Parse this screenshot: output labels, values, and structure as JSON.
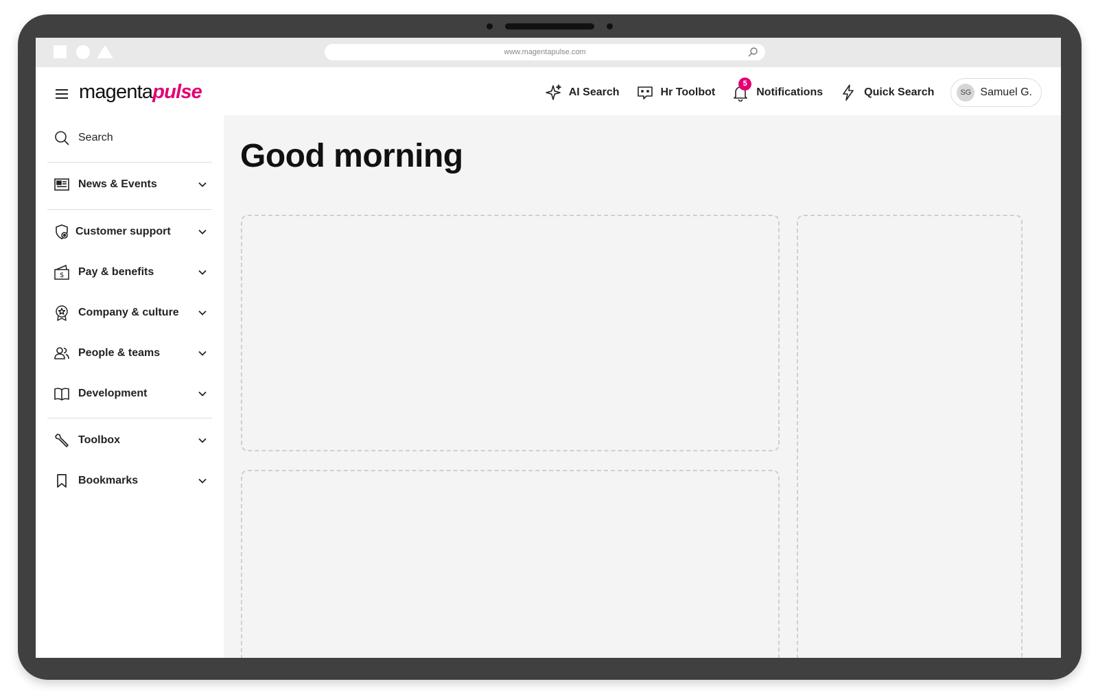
{
  "browser": {
    "url": "www.magentapulse.com"
  },
  "brand": {
    "logo_part_1": "magenta",
    "logo_part_2": "pulse",
    "accent_color": "#e20074"
  },
  "header": {
    "actions": [
      {
        "label": "AI Search",
        "icon": "sparkle-icon"
      },
      {
        "label": "Hr Toolbot",
        "icon": "chat-bot-icon"
      },
      {
        "label": "Notifications",
        "icon": "bell-icon",
        "badge": "5"
      },
      {
        "label": "Quick Search",
        "icon": "lightning-icon"
      }
    ],
    "user": {
      "initials": "SG",
      "name": "Samuel G."
    }
  },
  "sidebar": {
    "search_label": "Search",
    "items": [
      {
        "label": "News & Events",
        "icon": "newspaper-icon"
      },
      {
        "label": "Customer support",
        "icon": "shield-support-icon"
      },
      {
        "label": "Pay & benefits",
        "icon": "wallet-dollar-icon"
      },
      {
        "label": "Company & culture",
        "icon": "award-badge-icon"
      },
      {
        "label": "People & teams",
        "icon": "people-icon"
      },
      {
        "label": "Development",
        "icon": "open-book-icon"
      },
      {
        "label": "Toolbox",
        "icon": "wrench-icon"
      },
      {
        "label": "Bookmarks",
        "icon": "bookmark-icon"
      }
    ]
  },
  "main": {
    "greeting": "Good morning"
  }
}
